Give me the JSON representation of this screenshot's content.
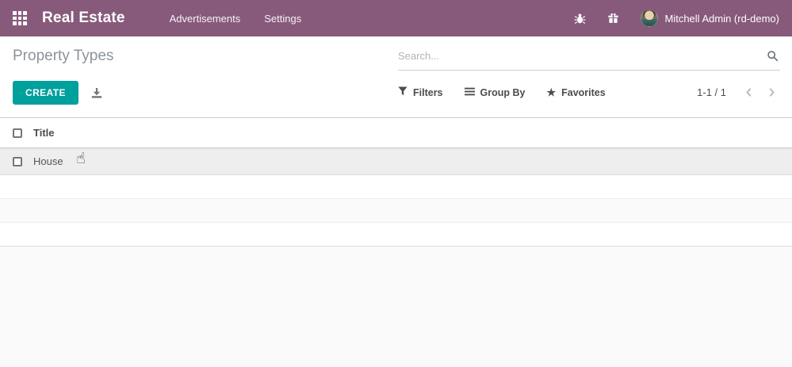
{
  "navbar": {
    "app_label": "Real Estate",
    "menu": [
      {
        "label": "Advertisements"
      },
      {
        "label": "Settings"
      }
    ],
    "icons": [
      "apps-grid-icon",
      "debug-bug-icon",
      "gift-icon"
    ],
    "user_name": "Mitchell Admin (rd-demo)"
  },
  "control_panel": {
    "title": "Property Types",
    "search": {
      "placeholder": "Search...",
      "icon": "magnifier-icon"
    },
    "create_label": "CREATE",
    "export_icon": "download-icon",
    "view_controls": [
      {
        "icon": "filter-funnel-icon",
        "label": "Filters"
      },
      {
        "icon": "group-lines-icon",
        "label": "Group By"
      },
      {
        "icon": "star-icon",
        "label": "Favorites",
        "star_glyph": "★"
      }
    ],
    "pager": {
      "value": "1-1 / 1",
      "prev_icon": "chevron-left-icon",
      "next_icon": "chevron-right-icon"
    }
  },
  "list_view": {
    "columns": [
      {
        "label": "Title"
      }
    ],
    "rows": [
      {
        "title": "House"
      }
    ],
    "cursor": {
      "icon": "hand-pointer-cursor",
      "glyph": "☝"
    }
  },
  "colors": {
    "navbar_bg": "#875a7b",
    "primary_button_bg": "#00a09d",
    "page_bg": "#f9f9f9",
    "hovered_row_bg": "#eeeeee",
    "title_text": "#8b939c",
    "body_text": "#4c4c4c"
  }
}
